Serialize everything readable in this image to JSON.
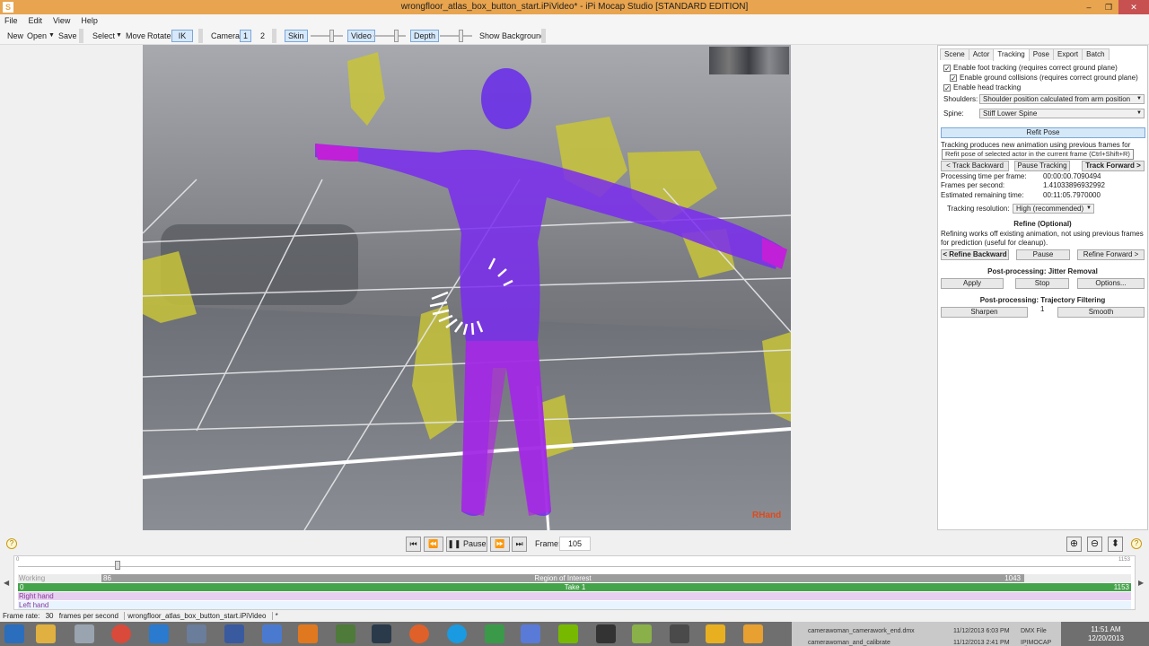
{
  "window": {
    "title": "wrongfloor_atlas_box_button_start.iPiVideo* - iPi Mocap Studio [STANDARD EDITION]",
    "app_icon": "S",
    "buttons": {
      "minimize": "–",
      "maximize": "❐",
      "close": "✕"
    }
  },
  "menu": [
    "File",
    "Edit",
    "View",
    "Help"
  ],
  "toolbar": {
    "new": "New",
    "open": "Open",
    "save": "Save",
    "select": "Select",
    "move": "Move",
    "rotate": "Rotate",
    "ik": "IK",
    "camera_label": "Camera:",
    "camera_1": "1",
    "camera_2": "2",
    "skin": "Skin",
    "video": "Video",
    "depth": "Depth",
    "show_background": "Show Background"
  },
  "viewport": {
    "actor_label": "RHand",
    "colors": {
      "floor": "#8a8e94",
      "actor": "#7a2cf0",
      "actor_hands": "#c020d8",
      "highlight": "#c8c43a"
    }
  },
  "panel": {
    "tabs": [
      "Scene",
      "Actor",
      "Tracking",
      "Pose",
      "Export",
      "Batch"
    ],
    "active_tab": "Tracking",
    "checkboxes": [
      {
        "label": "Enable foot tracking (requires correct ground plane)",
        "checked": true
      },
      {
        "label": "Enable ground collisions (requires correct ground plane)",
        "checked": true
      },
      {
        "label": "Enable head tracking",
        "checked": true
      }
    ],
    "shoulders_label": "Shoulders:",
    "shoulders_value": "Shoulder position calculated from arm position",
    "spine_label": "Spine:",
    "spine_value": "Stiff Lower Spine",
    "refit_pose": "Refit Pose",
    "tracking_note": "Tracking produces new animation using previous frames for",
    "tooltip": "Refit pose of selected actor in the current frame (Ctrl+Shift+R)",
    "track_backward": "< Track Backward",
    "pause_tracking": "Pause Tracking",
    "track_forward": "Track Forward >",
    "stats": [
      {
        "label": "Processing time per frame:",
        "value": "00:00:00.7090494"
      },
      {
        "label": "Frames per second:",
        "value": "1.41033896932992"
      },
      {
        "label": "Estimated remaining time:",
        "value": "00:11:05.7970000"
      }
    ],
    "tracking_resolution_label": "Tracking resolution:",
    "tracking_resolution_value": "High (recommended)",
    "refine_title": "Refine (Optional)",
    "refine_note": "Refining works off existing animation, not using previous frames for prediction (useful for cleanup).",
    "refine_backward": "< Refine Backward",
    "refine_pause": "Pause",
    "refine_forward": "Refine Forward >",
    "jitter_title": "Post-processing: Jitter Removal",
    "apply": "Apply",
    "stop": "Stop",
    "options": "Options...",
    "trajectory_title": "Post-processing: Trajectory Filtering",
    "sharpen": "Sharpen",
    "smooth_value": "1",
    "smooth": "Smooth"
  },
  "playback": {
    "pause": "Pause",
    "frame_label": "Frame:",
    "frame_value": "105",
    "help": "?"
  },
  "timeline": {
    "start": "0",
    "end": "1153",
    "working": "Working",
    "roi_start": "86",
    "roi_label": "Region of Interest",
    "roi_end": "1043",
    "take_start": "0",
    "take_label": "Take 1",
    "take_end": "1153",
    "right_hand": "Right hand",
    "left_hand": "Left hand"
  },
  "status": {
    "frame_rate_label": "Frame rate:",
    "frame_rate_value": "30",
    "fps_label": "frames per second",
    "file": "wrongfloor_atlas_box_button_start.iPiVideo",
    "modified": "*"
  },
  "taskbar": {
    "files": [
      {
        "name": "camerawoman_camerawork_end.dmx",
        "date": "11/12/2013 6:03 PM",
        "type": "DMX File"
      },
      {
        "name": "camerawoman_and_calibrate",
        "date": "11/12/2013 2:41 PM",
        "type": "IPIMOCAP File"
      }
    ],
    "time": "11:51 AM",
    "date": "12/20/2013"
  }
}
